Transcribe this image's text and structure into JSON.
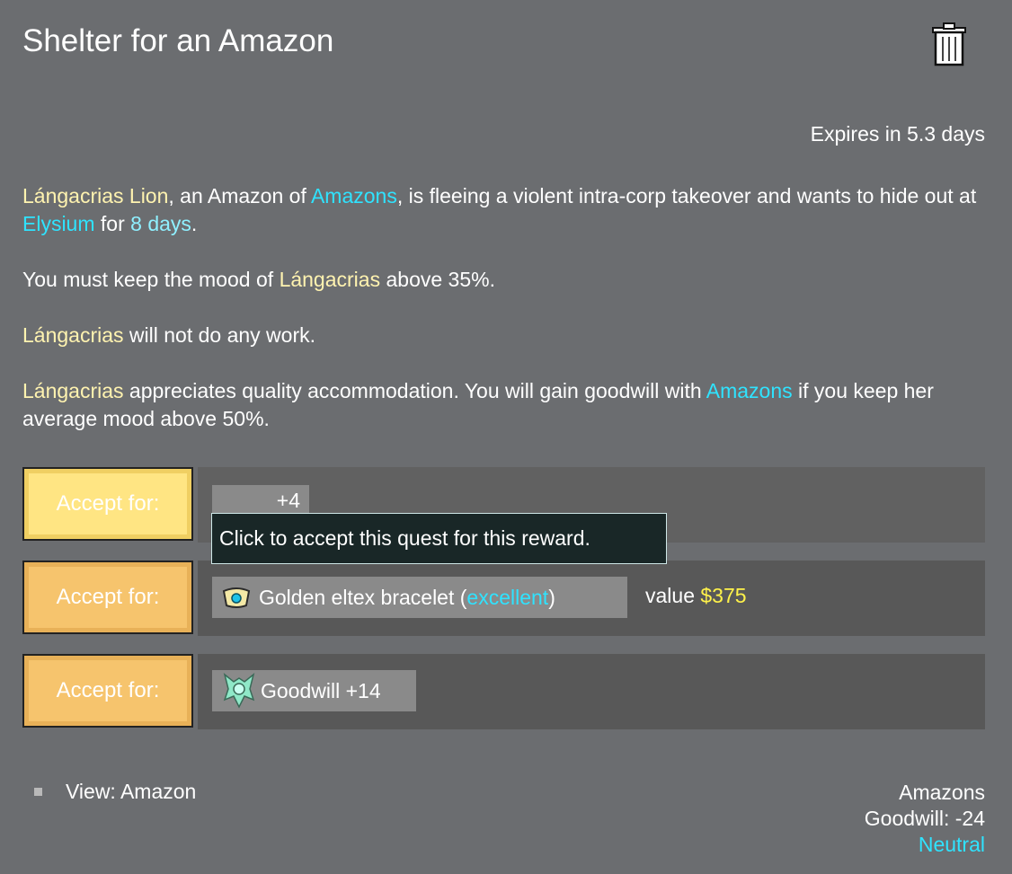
{
  "title": "Shelter for an Amazon",
  "expires": "Expires in 5.3 days",
  "description": {
    "p1": {
      "name": "Lángacrias Lion",
      "t1": ", an Amazon of ",
      "faction": "Amazons",
      "t2": ", is fleeing a violent intra-corp takeover and wants to hide out at ",
      "location": "Elysium",
      "t3": " for ",
      "duration": "8 days",
      "t4": "."
    },
    "p2": {
      "t1": "You must keep the mood of ",
      "name": "Lángacrias",
      "t2": " above 35%."
    },
    "p3": {
      "name": "Lángacrias",
      "t1": " will not do any work."
    },
    "p4": {
      "name": "Lángacrias",
      "t1": " appreciates quality accommodation. You will gain goodwill with ",
      "faction": "Amazons",
      "t2": " if you keep her average mood above 50%."
    }
  },
  "rewards": [
    {
      "button": "Accept for:",
      "label": "+4"
    },
    {
      "button": "Accept for:",
      "label": "Golden eltex bracelet (",
      "quality": "excellent",
      "label_end": ")",
      "value_label": "value ",
      "value": "$375",
      "icon": "bracelet-icon"
    },
    {
      "button": "Accept for:",
      "label": "Goodwill +14",
      "icon": "faction-emblem-icon"
    }
  ],
  "tooltip": "Click to accept this quest for this reward.",
  "view_link": "View: Amazon",
  "faction_status": {
    "name": "Amazons",
    "goodwill": "Goodwill: -24",
    "relation": "Neutral"
  },
  "colors": {
    "name": "#fff3b0",
    "highlight": "#2fe3ff",
    "value": "#fff24a",
    "button": "#f6c46d",
    "button_active": "#ffe583"
  }
}
